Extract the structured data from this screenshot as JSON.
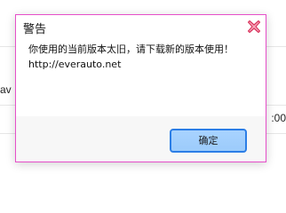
{
  "background": {
    "left_text": "av",
    "right_text": ":00"
  },
  "dialog": {
    "title": "警告",
    "message_line1": "你使用的当前版本太旧，请下载新的版本使用！",
    "message_line2": "http://everauto.net",
    "ok_label": "确定",
    "close_icon": "close-x-icon",
    "colors": {
      "border": "#e64fc9",
      "close_icon_fill": "#f7a6b8",
      "close_icon_stroke": "#d9365f",
      "ok_button_fill": "#a8d3ff",
      "ok_button_border": "#2c7ee6"
    }
  }
}
